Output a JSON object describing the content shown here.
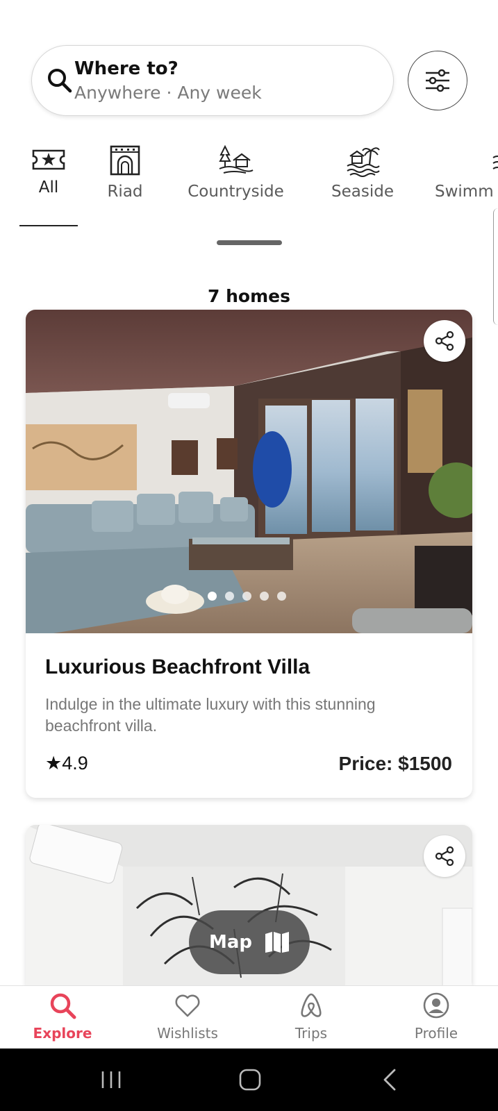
{
  "search": {
    "title": "Where to?",
    "subtitle": "Anywhere · Any week"
  },
  "categories": [
    {
      "label": "All",
      "icon": "ticket-star-icon",
      "active": true
    },
    {
      "label": "Riad",
      "icon": "riad-building-icon"
    },
    {
      "label": "Countryside",
      "icon": "countryside-icon"
    },
    {
      "label": "Seaside",
      "icon": "seaside-icon"
    },
    {
      "label": "Swimm",
      "icon": "pool-icon"
    }
  ],
  "results": {
    "count_label": "7 homes"
  },
  "listings": [
    {
      "title": "Luxurious Beachfront Villa",
      "description": "Indulge in the ultimate luxury with this stunning beachfront villa.",
      "rating": "★4.9",
      "price": "Price: $1500",
      "photo_count": 5,
      "active_photo": 0
    }
  ],
  "map_button": {
    "label": "Map"
  },
  "bottom_nav": [
    {
      "label": "Explore",
      "icon": "search-icon",
      "active": true
    },
    {
      "label": "Wishlists",
      "icon": "heart-icon"
    },
    {
      "label": "Trips",
      "icon": "airbnb-logo-icon"
    },
    {
      "label": "Profile",
      "icon": "user-circle-icon"
    }
  ],
  "colors": {
    "accent": "#e8445a",
    "nav_inactive": "#777777",
    "text_primary": "#111111",
    "text_secondary": "#777777"
  }
}
